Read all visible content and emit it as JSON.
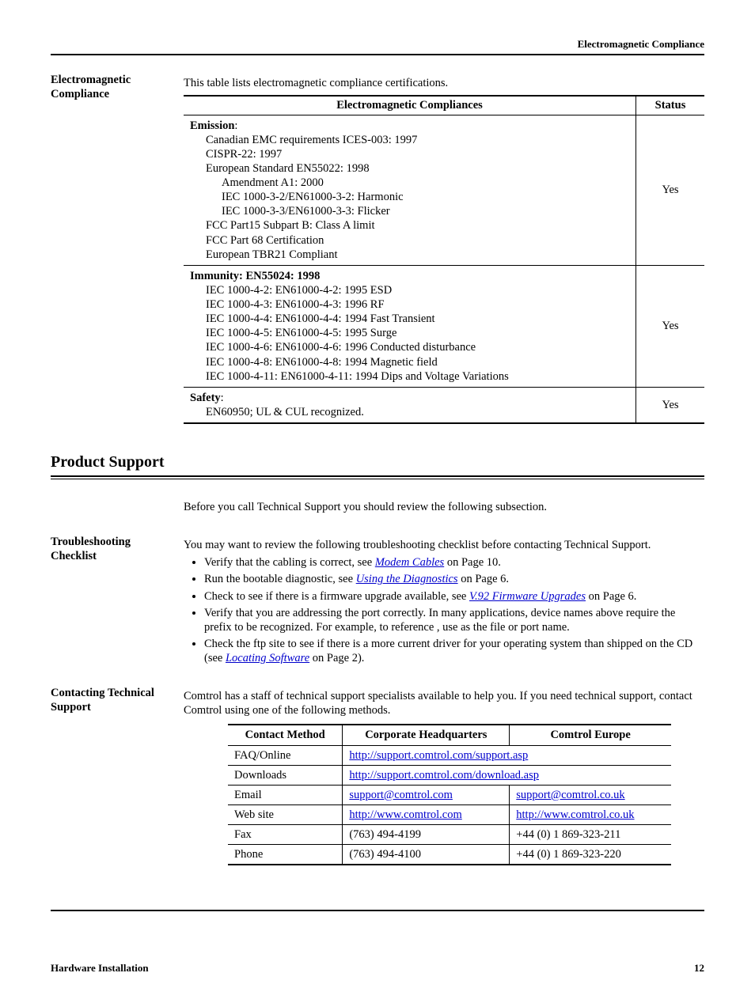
{
  "running_head": "Electromagnetic Compliance",
  "em_section": {
    "side_head": "Electromagnetic Compliance",
    "intro": "This table lists electromagnetic compliance certifications.",
    "header_compliances": "Electromagnetic Compliances",
    "header_status": "Status",
    "rows": [
      {
        "title": "Emission",
        "lines1": [
          "Canadian EMC requirements ICES-003: 1997",
          "CISPR-22: 1997",
          "European Standard EN55022: 1998"
        ],
        "lines2": [
          "Amendment A1: 2000",
          "IEC 1000-3-2/EN61000-3-2: Harmonic",
          "IEC 1000-3-3/EN61000-3-3: Flicker"
        ],
        "lines1b": [
          "FCC Part15 Subpart B: Class A limit",
          "FCC Part 68 Certification",
          "European TBR21 Compliant"
        ],
        "status": "Yes"
      },
      {
        "title_full": "Immunity: EN55024: 1998",
        "lines1": [
          "IEC 1000-4-2: EN61000-4-2: 1995 ESD",
          "IEC 1000-4-3: EN61000-4-3: 1996 RF",
          "IEC 1000-4-4: EN61000-4-4: 1994 Fast Transient",
          "IEC 1000-4-5: EN61000-4-5: 1995 Surge",
          "IEC 1000-4-6: EN61000-4-6: 1996 Conducted disturbance",
          "IEC 1000-4-8: EN61000-4-8: 1994 Magnetic field",
          "IEC 1000-4-11: EN61000-4-11: 1994 Dips and Voltage Variations"
        ],
        "status": "Yes"
      },
      {
        "title": "Safety",
        "lines1": [
          "EN60950; UL & CUL recognized."
        ],
        "status": "Yes"
      }
    ]
  },
  "support_section": {
    "heading": "Product Support",
    "intro": "Before you call Technical Support you should review the following subsection."
  },
  "troubleshoot": {
    "side_head": "Troubleshooting Checklist",
    "intro": "You may want to review the following troubleshooting checklist before contacting Technical Support.",
    "b1_pre": "Verify that the cabling is correct, see ",
    "b1_link": "Modem Cables",
    "b1_post": " on Page 10.",
    "b2_pre": "Run the bootable diagnostic, see ",
    "b2_link": "Using the Diagnostics",
    "b2_post": " on Page 6.",
    "b3_pre": "Check to see if there is a firmware upgrade available, see ",
    "b3_link": "V.92 Firmware Upgrades",
    "b3_post": " on Page 6.",
    "b4": "Verify that you are addressing the port correctly. In many applications, device names above      require the prefix    to be recognized. For example, to reference      , use       as the file or port name.",
    "b5_pre": "Check the ftp site to see if there is a more current driver for your operating system than shipped on the CD (see ",
    "b5_link": "Locating Software",
    "b5_post": " on Page 2)."
  },
  "contact": {
    "side_head": "Contacting Technical Support",
    "intro": "Comtrol has a staff of technical support specialists available to help you. If you need technical support, contact Comtrol using one of the following methods.",
    "head_method": "Contact Method",
    "head_hq": "Corporate Headquarters",
    "head_eu": "Comtrol Europe",
    "rows": {
      "faq_label": "FAQ/Online",
      "faq_link": "http://support.comtrol.com/support.asp",
      "dl_label": "Downloads",
      "dl_link": "http://support.comtrol.com/download.asp",
      "email_label": "Email",
      "email_hq": "support@comtrol.com",
      "email_eu": "support@comtrol.co.uk",
      "web_label": "Web site",
      "web_hq": "http://www.comtrol.com",
      "web_eu": "http://www.comtrol.co.uk",
      "fax_label": "Fax",
      "fax_hq": "(763) 494-4199",
      "fax_eu": "+44 (0) 1 869-323-211",
      "phone_label": "Phone",
      "phone_hq": "(763) 494-4100",
      "phone_eu": "+44 (0) 1 869-323-220"
    }
  },
  "footer": {
    "left": "Hardware Installation",
    "right": "12"
  }
}
